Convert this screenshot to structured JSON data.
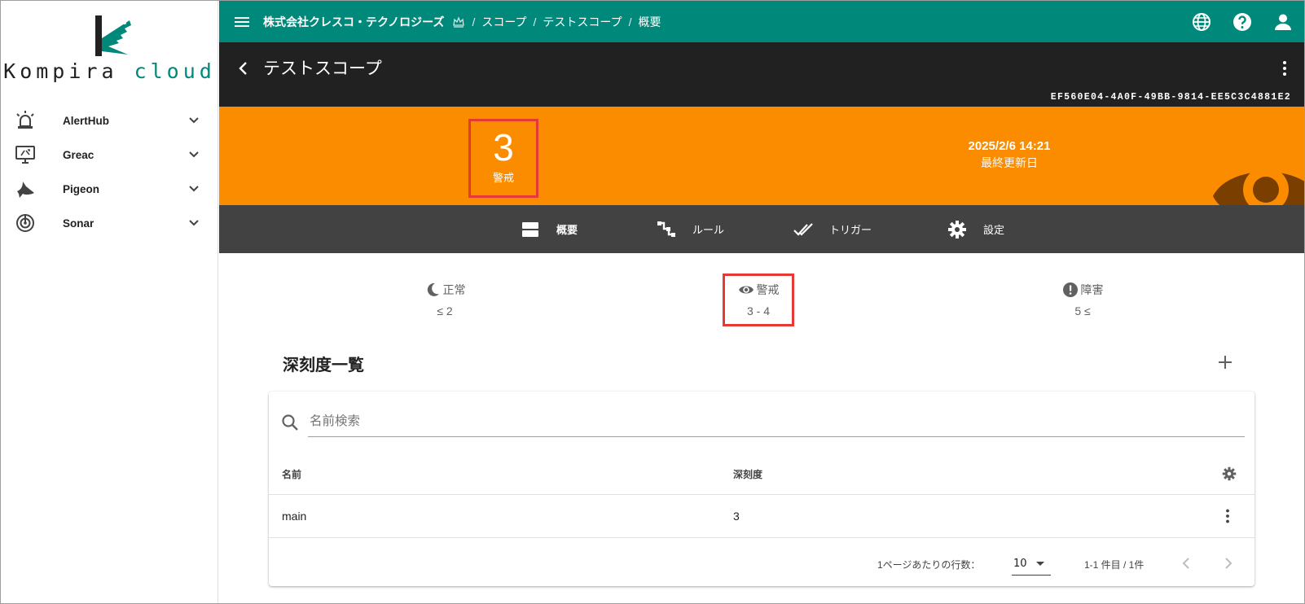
{
  "brand": {
    "logo_main": "Kompira",
    "logo_sub": "cloud",
    "accent": "#00897b"
  },
  "sidebar": {
    "items": [
      {
        "label": "AlertHub",
        "icon": "siren-icon"
      },
      {
        "label": "Greac",
        "icon": "monitor-icon"
      },
      {
        "label": "Pigeon",
        "icon": "pigeon-icon"
      },
      {
        "label": "Sonar",
        "icon": "sonar-icon"
      }
    ]
  },
  "topbar": {
    "org": "株式会社クレスコ・テクノロジーズ",
    "breadcrumb": [
      "スコープ",
      "テストスコープ",
      "概要"
    ],
    "sep": "/",
    "actions": [
      "globe-icon",
      "help-icon",
      "account-icon"
    ]
  },
  "scope": {
    "title": "テストスコープ",
    "uuid": "EF560E04-4A0F-49BB-9814-EE5C3C4881E2"
  },
  "status": {
    "level": "3",
    "level_label": "警戒",
    "updated_at": "2025/2/6 14:21",
    "updated_label": "最終更新日",
    "banner_color": "#fb8c00",
    "highlight_color": "#e53935"
  },
  "tabs": [
    {
      "label": "概要",
      "active": true
    },
    {
      "label": "ルール",
      "active": false
    },
    {
      "label": "トリガー",
      "active": false
    },
    {
      "label": "設定",
      "active": false
    }
  ],
  "thresholds": [
    {
      "label": "正常",
      "range": "≤ 2",
      "icon": "moon-icon"
    },
    {
      "label": "警戒",
      "range": "3 - 4",
      "icon": "eye-icon"
    },
    {
      "label": "障害",
      "range": "5 ≤",
      "icon": "alert-circle-icon"
    }
  ],
  "severity_list": {
    "title": "深刻度一覧",
    "search_placeholder": "名前検索",
    "columns": [
      "名前",
      "深刻度"
    ],
    "rows": [
      {
        "name": "main",
        "severity": "3"
      }
    ],
    "rows_per_page_label": "1ページあたりの行数：",
    "rows_per_page": "10",
    "range_label": "1-1 件目 / 1件"
  }
}
